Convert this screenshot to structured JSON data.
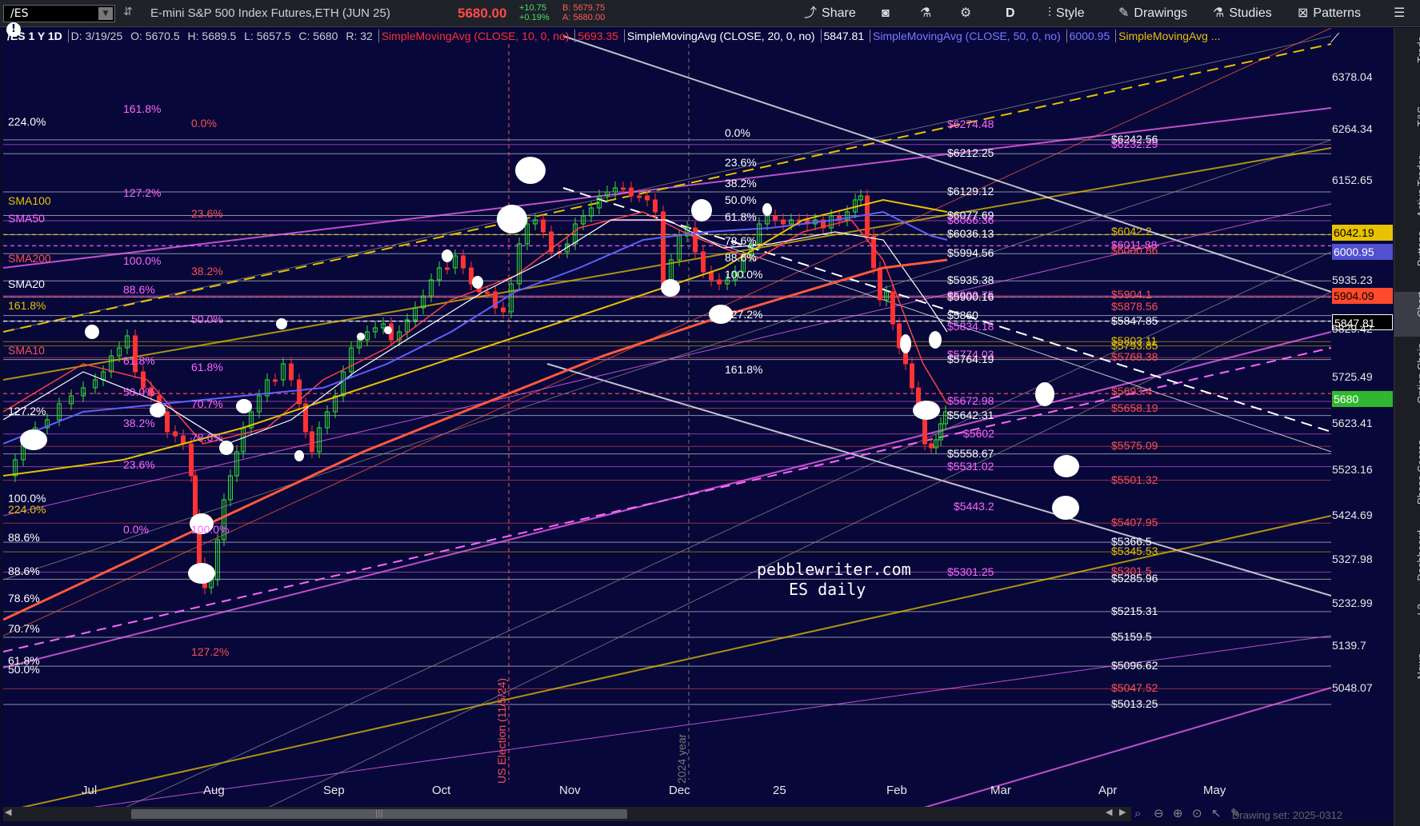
{
  "toolbar": {
    "symbol": "/ES",
    "description": "E-mini S&P 500 Index Futures,ETH (JUN 25)",
    "last": "5680.00",
    "change_abs": "+10.75",
    "change_pct": "+0.19%",
    "bid": "B: 5679.75",
    "ask": "A: 5680.00",
    "buttons": {
      "share": "Share",
      "aggregation": "D",
      "style": "Style",
      "drawings": "Drawings",
      "studies": "Studies",
      "patterns": "Patterns"
    }
  },
  "study_strip": {
    "instrument": "/ES 1 Y 1D",
    "date": "D: 3/19/25",
    "open": "O: 5670.5",
    "high": "H: 5689.5",
    "low": "L: 5657.5",
    "close": "C: 5680",
    "range": "R: 32",
    "sma10_label": "SimpleMovingAvg (CLOSE, 10, 0, no)",
    "sma10_value": "5693.35",
    "sma20_label": "SimpleMovingAvg (CLOSE, 20, 0, no)",
    "sma20_value": "5847.81",
    "sma50_label": "SimpleMovingAvg (CLOSE, 50, 0, no)",
    "sma50_value": "6000.95",
    "sma100_label": "SimpleMovingAvg ..."
  },
  "colors": {
    "sma10": "#ff4040",
    "sma20": "#ffffff",
    "sma50": "#6060ff",
    "sma100": "#e6c200",
    "sma200": "#ff5a3c",
    "fib_magenta": "#ff66ff",
    "up_candle": "#33dd33",
    "down_candle": "#ff3333"
  },
  "price_axis": {
    "ticks": [
      "6378.04",
      "6264.34",
      "6152.65",
      "6042.19",
      "6000.95",
      "5935.23",
      "5904.09",
      "5847.81",
      "5829.42",
      "5725.49",
      "5680",
      "5623.41",
      "5523.16",
      "5424.69",
      "5327.98",
      "5232.99",
      "5139.7",
      "5048.07"
    ]
  },
  "time_axis": {
    "labels": [
      "Jul",
      "Aug",
      "Sep",
      "Oct",
      "Nov",
      "Dec",
      "25",
      "Feb",
      "Mar",
      "Apr",
      "May"
    ]
  },
  "sidebar": {
    "tabs": [
      "Trade",
      "T&S",
      "Active Trader",
      "Buttons",
      "Chart",
      "Option Chain",
      "Phase Scores",
      "Dashboard",
      "L2",
      "News"
    ]
  },
  "watermark": {
    "site": "pebblewriter.com",
    "subtitle": "ES daily"
  },
  "annotations": {
    "election": "US Election (11/5/24)",
    "year": "2024 year",
    "sma_labels": [
      "SMA100",
      "SMA50",
      "SMA200",
      "SMA20",
      "SMA10"
    ]
  },
  "right_levels": [
    "$6274.48",
    "$6242.56",
    "$6232.29",
    "$6212.25",
    "$6129.12",
    "$6077.69",
    "$6066.36",
    "$6036.13",
    "$6042.2",
    "$6011.88",
    "$6000.86",
    "$5994.56",
    "$5935.38",
    "$5904.1",
    "$5902.75",
    "$5900.16",
    "$5878.56",
    "$5860",
    "$5847.85",
    "$5834.18",
    "$5803.11",
    "$5793.85",
    "$5774.03",
    "$5764.19",
    "$5768.38",
    "$5693.4",
    "$5672.98",
    "$5658.19",
    "$5642.31",
    "$5602",
    "$5575.09",
    "$5558.67",
    "$5531.02",
    "$5501.32",
    "$5443.2",
    "$5407.95",
    "$5366.5",
    "$5345.53",
    "$5301.25",
    "$5301.5",
    "$5285.96",
    "$5215.31",
    "$5159.5",
    "$5096.62",
    "$5047.52",
    "$5013.25"
  ],
  "left_fibs": [
    "161.8%",
    "224.0%",
    "0.0%",
    "127.2%",
    "23.6%",
    "100.0%",
    "38.2%",
    "88.6%",
    "161.8%",
    "50.0%",
    "61.8%",
    "61.8%",
    "50.0%",
    "70.7%",
    "127.2%",
    "38.2%",
    "78.6%",
    "23.6%",
    "88.6%",
    "100.0%",
    "224.0%",
    "0.0%",
    "100.0%",
    "88.6%",
    "78.6%",
    "70.7%",
    "61.8%",
    "127.2%",
    "50.0%"
  ],
  "mid_fibs": [
    "0.0%",
    "23.6%",
    "38.2%",
    "50.0%",
    "61.8%",
    "78.6%",
    "88.6%",
    "100.0%",
    "127.2%",
    "161.8%"
  ],
  "footer": {
    "drawing_set": "Drawing set: 2025-0312"
  }
}
